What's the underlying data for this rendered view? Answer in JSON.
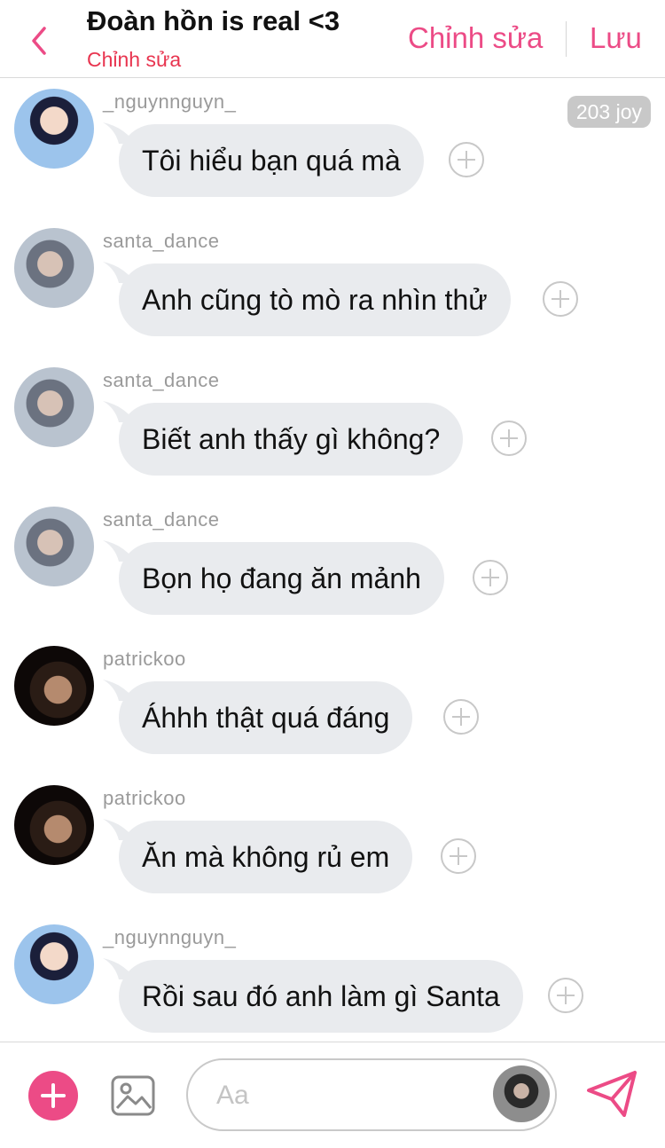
{
  "header": {
    "title": "Đoàn hồn is real <3",
    "subtitle": "Chỉnh sửa",
    "edit_label": "Chỉnh sửa",
    "save_label": "Lưu"
  },
  "joy_badge": "203 joy",
  "messages": [
    {
      "user": "_nguynnguyn_",
      "text": "Tôi hiểu bạn quá mà"
    },
    {
      "user": "santa_dance",
      "text": "Anh cũng tò mò ra nhìn thử"
    },
    {
      "user": "santa_dance",
      "text": "Biết anh thấy gì không?"
    },
    {
      "user": "santa_dance",
      "text": "Bọn họ đang ăn mảnh"
    },
    {
      "user": "patrickoo",
      "text": "Áhhh thật quá đáng"
    },
    {
      "user": "patrickoo",
      "text": "Ăn mà không rủ em"
    },
    {
      "user": "_nguynnguyn_",
      "text": "Rồi sau đó anh làm gì Santa"
    }
  ],
  "composer": {
    "placeholder": "Aa"
  },
  "colors": {
    "accent": "#ec4b86",
    "subtitle": "#e8344f",
    "bubble": "#e9ebee"
  },
  "icons": {
    "back": "chevron-left-icon",
    "add": "plus-circle-icon",
    "image": "image-icon",
    "send": "send-icon",
    "reaction": "add-reaction-icon"
  }
}
